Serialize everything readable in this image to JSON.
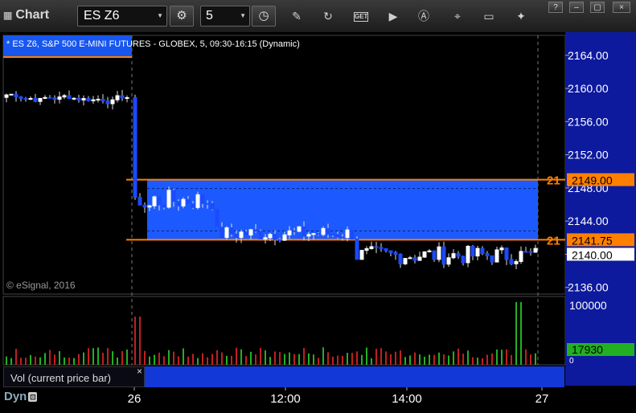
{
  "app": {
    "title": "Chart",
    "symbol": "ES Z6",
    "interval": "5",
    "toolbar_icons": [
      "settings-gear-icon",
      "clock-icon",
      "pencil-icon",
      "refresh-icon",
      "get-icon",
      "play-icon",
      "alert-icon",
      "pin-icon",
      "chat-icon",
      "twitter-icon"
    ],
    "window_controls": [
      "?",
      "–",
      "▢",
      "×"
    ]
  },
  "chart": {
    "info": "* ES Z6, S&P 500 E-MINI FUTURES - GLOBEX, 5, 09:30-16:15 (Dynamic)",
    "copyright": "© eSignal, 2016",
    "price_axis": [
      "2164.00",
      "2160.00",
      "2156.00",
      "2152.00",
      "2148.00",
      "2144.00",
      "2140.00",
      "2136.00"
    ],
    "price_range": [
      2135.2,
      2166.4
    ],
    "markers": {
      "upper": {
        "label": "2149.00",
        "value": 2149.0,
        "tag": "21",
        "color": "#ff8000"
      },
      "lower": {
        "label": "2141.75",
        "value": 2141.75,
        "tag": "21",
        "color": "#ff8000"
      },
      "last": {
        "label": "2140.00",
        "value": 2140.0
      }
    },
    "zone_color": "#1c5aff",
    "time_axis": [
      "26",
      "12:00",
      "14:00",
      "27"
    ],
    "volume": {
      "label": "Vol (current price bar)",
      "axis_top": "100000",
      "axis_bottom": "0",
      "current": "17930",
      "current_color": "#22b022"
    },
    "footer": "Dyn"
  }
}
